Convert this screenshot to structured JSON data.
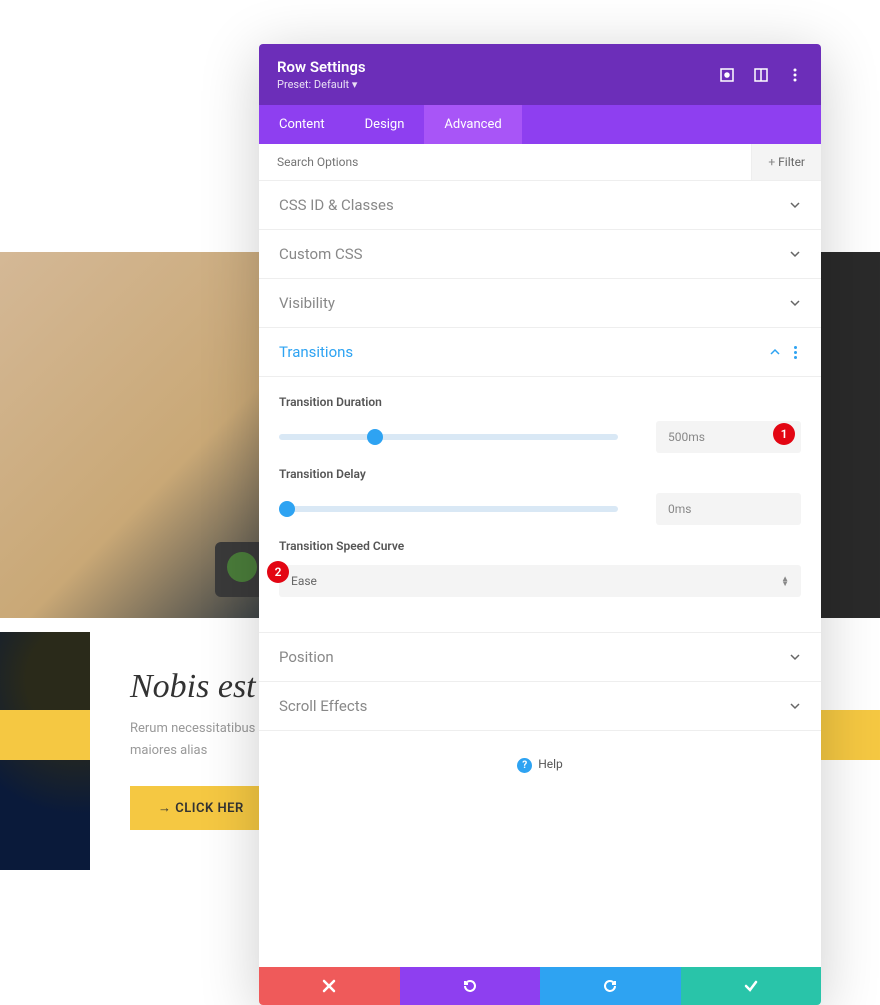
{
  "header": {
    "title": "Row Settings",
    "preset": "Preset: Default"
  },
  "tabs": [
    "Content",
    "Design",
    "Advanced"
  ],
  "search": {
    "placeholder": "Search Options",
    "filter": "Filter"
  },
  "sections": {
    "css_id": "CSS ID & Classes",
    "custom_css": "Custom CSS",
    "visibility": "Visibility",
    "transitions": "Transitions",
    "position": "Position",
    "scroll": "Scroll Effects"
  },
  "transitions": {
    "duration": {
      "label": "Transition Duration",
      "value": "500ms",
      "percent": 26
    },
    "delay": {
      "label": "Transition Delay",
      "value": "0ms",
      "percent": 0
    },
    "curve": {
      "label": "Transition Speed Curve",
      "value": "Ease"
    }
  },
  "help": "Help",
  "badges": {
    "one": "1",
    "two": "2"
  },
  "page": {
    "title": "Nobis est",
    "text": "Rerum necessitatibus saep recusandae. Itaque earum r voluptatibus maiores alias",
    "button": "CLICK HER"
  }
}
